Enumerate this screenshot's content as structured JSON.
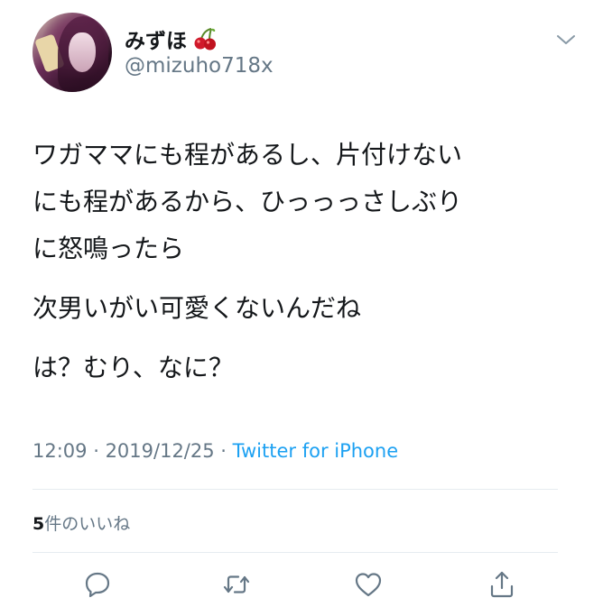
{
  "user": {
    "display_name": "みずほ",
    "emoji": "cherry-emoji",
    "handle": "@mizuho718x"
  },
  "tweet": {
    "paragraphs": [
      "ワガママにも程があるし、片付けない\nにも程があるから、ひっっっさしぶり\nに怒鳴ったら",
      "次男いがい可愛くないんだね",
      "は？むり、なに？"
    ]
  },
  "meta": {
    "time": "12:09",
    "separator1": " · ",
    "date": "2019/12/25",
    "separator2": " · ",
    "source": "Twitter for iPhone"
  },
  "stats": {
    "likes_count": "5",
    "likes_label": "件のいいね"
  },
  "actions": [
    {
      "icon": "reply-icon"
    },
    {
      "icon": "retweet-icon"
    },
    {
      "icon": "like-icon"
    },
    {
      "icon": "share-icon"
    }
  ],
  "colors": {
    "text": "#14171a",
    "secondary": "#657786",
    "link": "#1da1f2",
    "divider": "#e6ecf0"
  }
}
